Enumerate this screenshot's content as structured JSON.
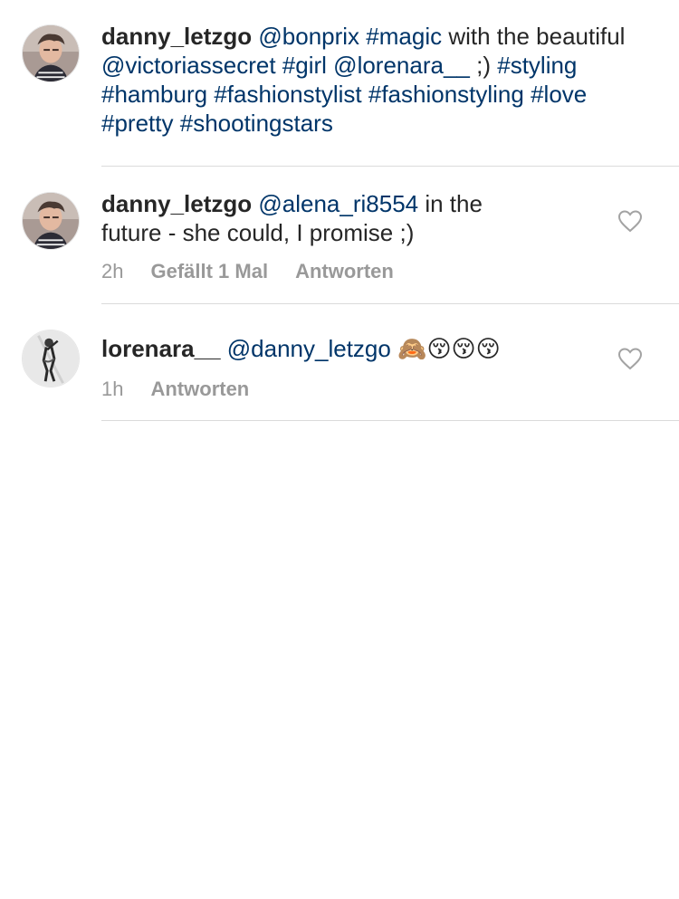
{
  "caption": {
    "username": "danny_letzgo",
    "parts": [
      {
        "t": "@bonprix",
        "link": true
      },
      {
        "t": " ",
        "link": false
      },
      {
        "t": "#magic",
        "link": true
      },
      {
        "t": " with the beautiful ",
        "link": false
      },
      {
        "t": "@victoriassecret",
        "link": true
      },
      {
        "t": " ",
        "link": false
      },
      {
        "t": "#girl",
        "link": true
      },
      {
        "t": " ",
        "link": false
      },
      {
        "t": "@lorenara__",
        "link": true
      },
      {
        "t": " ;) ",
        "link": false
      },
      {
        "t": "#styling",
        "link": true
      },
      {
        "t": " ",
        "link": false
      },
      {
        "t": "#hamburg",
        "link": true
      },
      {
        "t": " ",
        "link": false
      },
      {
        "t": "#fashionstylist",
        "link": true
      },
      {
        "t": " ",
        "link": false
      },
      {
        "t": "#fashionstyling",
        "link": true
      },
      {
        "t": " ",
        "link": false
      },
      {
        "t": "#love",
        "link": true
      },
      {
        "t": " ",
        "link": false
      },
      {
        "t": "#pretty",
        "link": true
      },
      {
        "t": " ",
        "link": false
      },
      {
        "t": "#shootingstars",
        "link": true
      }
    ]
  },
  "comments": [
    {
      "username": "danny_letzgo",
      "parts": [
        {
          "t": "@alena_ri8554",
          "link": true
        },
        {
          "t": " in the future - she could, I promise ;)",
          "link": false
        }
      ],
      "time": "2h",
      "likes": "Gefällt 1 Mal",
      "reply": "Antworten",
      "like_icon": "heart-outline-icon"
    },
    {
      "username": "lorenara__",
      "parts": [
        {
          "t": "@danny_letzgo",
          "link": true
        },
        {
          "t": " 🙈😚😚😚",
          "link": false
        }
      ],
      "time": "1h",
      "reply": "Antworten",
      "like_icon": "heart-outline-icon"
    }
  ],
  "colors": {
    "text": "#262626",
    "link": "#003569",
    "meta": "#999999",
    "divider": "#dbdbdb"
  }
}
